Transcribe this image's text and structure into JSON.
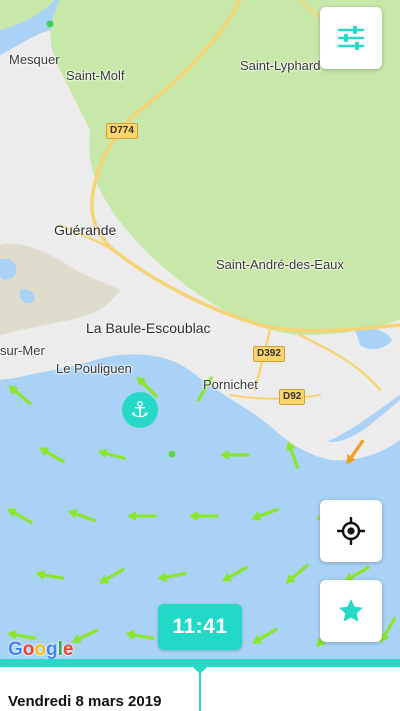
{
  "map": {
    "places": [
      {
        "name": "Mesquer"
      },
      {
        "name": "Saint-Molf"
      },
      {
        "name": "Saint-Lyphard"
      },
      {
        "name": "Guérande"
      },
      {
        "name": "Saint-André-des-Eaux"
      },
      {
        "name": "La Baule-Escoublac"
      },
      {
        "name": "Le Pouliguen"
      },
      {
        "name": "sur-Mer"
      },
      {
        "name": "Pornichet"
      }
    ],
    "roads": [
      "D774",
      "D392",
      "D92"
    ],
    "colors": {
      "water": "#a9d2f6",
      "land": "#ececec",
      "forest": "#c7e8a8",
      "road": "#f6d473",
      "wind_arrow": "#8ae62a",
      "wind_arrow_strong": "#f0a020",
      "accent": "#25d9c6"
    }
  },
  "overlay": {
    "anchor_icon": "anchor-icon",
    "time": "11:41",
    "date": "Vendredi 8 mars 2019",
    "attribution": "Google"
  },
  "controls": {
    "settings_icon": "sliders-icon",
    "locate_icon": "crosshair-icon",
    "favorite_icon": "star-icon"
  }
}
